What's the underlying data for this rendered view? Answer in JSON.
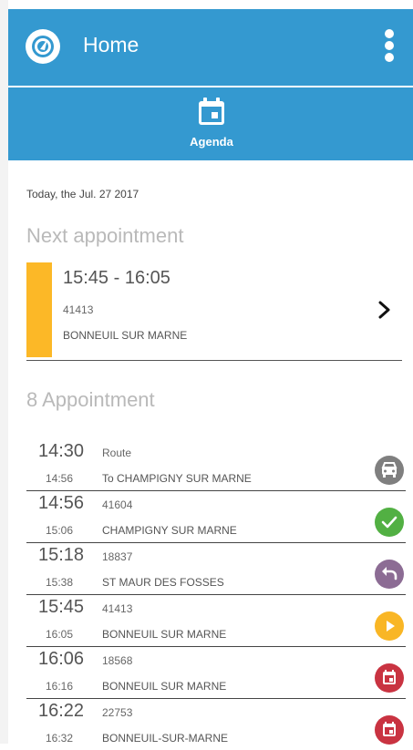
{
  "appbar": {
    "title": "Home",
    "logo_icon": "gauge-icon",
    "menu_icon": "more-vertical-icon"
  },
  "tabs": [
    {
      "label": "Agenda",
      "icon": "calendar-icon"
    }
  ],
  "agenda": {
    "today_label": "Today, the Jul. 27 2017",
    "next_heading": "Next appointment",
    "next": {
      "time": "15:45 - 16:05",
      "code": "41413",
      "place": "BONNEUIL SUR MARNE",
      "color": "#fcb827"
    },
    "count_heading": "8 Appointment",
    "items": [
      {
        "start": "14:30",
        "end": "14:56",
        "title": "Route",
        "subtitle": "To CHAMPIGNY SUR MARNE",
        "status": "car-icon",
        "color": "#7f7f7f"
      },
      {
        "start": "14:56",
        "end": "15:06",
        "title": "41604",
        "subtitle": "CHAMPIGNY SUR MARNE",
        "status": "check-icon",
        "color": "#52b043"
      },
      {
        "start": "15:18",
        "end": "15:38",
        "title": "18837",
        "subtitle": "ST MAUR DES FOSSES",
        "status": "undo-icon",
        "color": "#8c6c94"
      },
      {
        "start": "15:45",
        "end": "16:05",
        "title": "41413",
        "subtitle": "BONNEUIL SUR MARNE",
        "status": "play-icon",
        "color": "#f9b625"
      },
      {
        "start": "16:06",
        "end": "16:16",
        "title": "18568",
        "subtitle": "BONNEUIL SUR MARNE",
        "status": "calendar-icon",
        "color": "#c93341"
      },
      {
        "start": "16:22",
        "end": "16:32",
        "title": "22753",
        "subtitle": "BONNEUIL-SUR-MARNE",
        "status": "calendar-icon",
        "color": "#c93341"
      }
    ]
  }
}
